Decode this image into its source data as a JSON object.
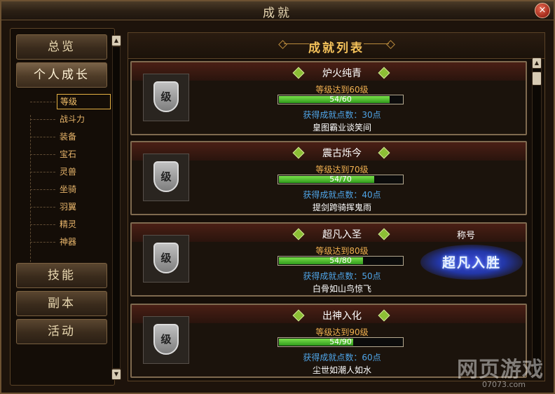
{
  "window": {
    "title": "成就",
    "close_icon": "×"
  },
  "nav": {
    "overview": "总览",
    "personal_growth": "个人成长",
    "sub_items": [
      "等级",
      "战斗力",
      "装备",
      "宝石",
      "灵兽",
      "坐骑",
      "羽翼",
      "精灵",
      "神器"
    ],
    "skills": "技能",
    "dungeon": "副本",
    "events": "活动"
  },
  "list": {
    "title": "成就列表",
    "cards": [
      {
        "name": "炉火纯青",
        "icon_label": "级",
        "requirement": "等级达到60级",
        "progress_text": "54/60",
        "progress": 0.9,
        "points_text": "获得成就点数：30点",
        "reward": "皇图霸业谈笑间"
      },
      {
        "name": "震古烁今",
        "icon_label": "级",
        "requirement": "等级达到70级",
        "progress_text": "54/70",
        "progress": 0.77,
        "points_text": "获得成就点数：40点",
        "reward": "提剑跨骑挥鬼雨"
      },
      {
        "name": "超凡入圣",
        "icon_label": "级",
        "requirement": "等级达到80级",
        "progress_text": "54/80",
        "progress": 0.68,
        "points_text": "获得成就点数：50点",
        "reward": "白骨如山鸟惊飞",
        "title_label": "称号",
        "title_emblem": "超凡入胜"
      },
      {
        "name": "出神入化",
        "icon_label": "级",
        "requirement": "等级达到90级",
        "progress_text": "54/90",
        "progress": 0.6,
        "points_text": "获得成就点数：60点",
        "reward": "尘世如潮人如水"
      }
    ]
  },
  "watermark": {
    "logo": "网页游戏",
    "url": "07073.com"
  },
  "colors": {
    "accent": "#f3c15a",
    "progress": "#4fc42c",
    "points": "#4fa5e8"
  }
}
